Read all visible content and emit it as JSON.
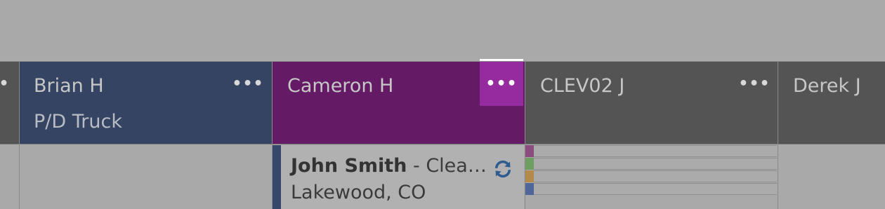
{
  "colors": {
    "background": "#a9a9a9",
    "brian_header": "#344462",
    "cameron_header": "#641a64",
    "cameron_menu_active": "#952b9e",
    "clev_header": "#545454",
    "derek_header": "#545454",
    "card_accent": "#36476b",
    "sync_icon": "#2f5c8f"
  },
  "columns": [
    {
      "name": "",
      "sub": ""
    },
    {
      "name": "Brian H",
      "sub": "P/D Truck"
    },
    {
      "name": "Cameron H",
      "sub": ""
    },
    {
      "name": "CLEV02 J",
      "sub": ""
    },
    {
      "name": "Derek J",
      "sub": ""
    }
  ],
  "menu_glyph": "•••",
  "card": {
    "name": "John Smith",
    "detail": " - Clea…",
    "location": "Lakewood, CO",
    "icon": "sync-icon"
  },
  "clev_lane_colors": [
    "#8a4d7e",
    "#6e9e62",
    "#b48a4a",
    "#50669a"
  ]
}
